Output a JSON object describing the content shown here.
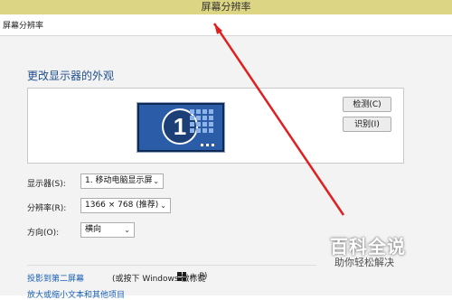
{
  "window": {
    "title": "屏幕分辨率"
  },
  "address": {
    "text": "屏幕分辨率"
  },
  "main": {
    "heading": "更改显示器的外观",
    "monitor_number": "1",
    "detect_label": "检测(C)",
    "identify_label": "识别(I)"
  },
  "settings": {
    "display_label": "显示器(S):",
    "display_value": "1. 移动电脑显示屏",
    "resolution_label": "分辨率(R):",
    "resolution_value": "1366 × 768 (推荐)",
    "orientation_label": "方向(O):",
    "orientation_value": "横向"
  },
  "links": {
    "project_link": "投影到第二屏幕",
    "project_note": "(或按下 Windows 徽标键",
    "project_note_tail": "+ P)",
    "text_size_link": "放大或缩小文本和其他项目"
  },
  "watermark": {
    "main": "百科全说",
    "sub": "助你轻松解决"
  },
  "colors": {
    "banner": "#dcd584",
    "accent": "#1f4e8c",
    "link": "#1a5fb4",
    "arrow": "#e02020"
  },
  "icons": {
    "select_chevron": "chevron-down-icon",
    "windows_logo": "windows-logo-icon",
    "monitor": "monitor-icon"
  }
}
